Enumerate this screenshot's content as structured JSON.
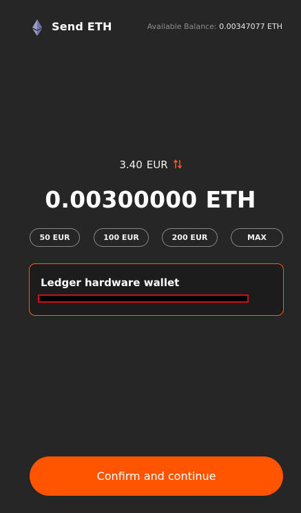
{
  "header": {
    "icon": "ethereum-icon",
    "title": "Send ETH",
    "balance_label": "Available Balance:",
    "balance_value": "0.00347077 ETH"
  },
  "amount": {
    "fiat_value": "3.40",
    "fiat_currency": "EUR",
    "swap_icon": "swap-arrows-icon",
    "crypto_value": "0.00300000",
    "crypto_unit": "ETH"
  },
  "quick_amounts": [
    "50 EUR",
    "100 EUR",
    "200 EUR",
    "MAX"
  ],
  "wallet": {
    "label": "Ledger hardware wallet"
  },
  "actions": {
    "confirm_label": "Confirm and continue"
  },
  "colors": {
    "background": "#262626",
    "accent": "#ff5500",
    "card_border": "#ff5a1f",
    "redaction_border": "#d01010"
  }
}
